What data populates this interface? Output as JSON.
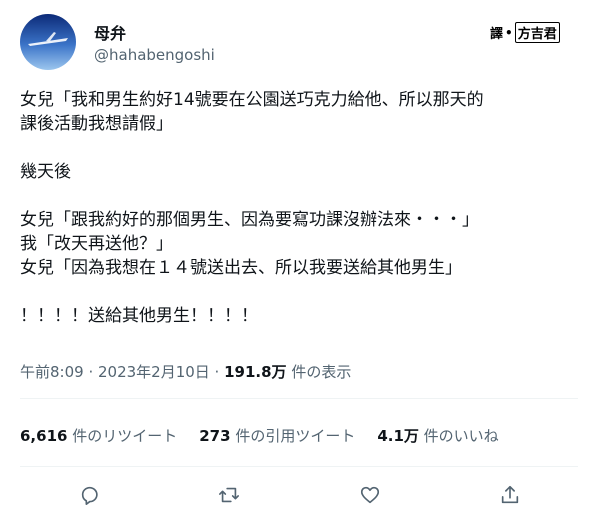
{
  "author": {
    "name": "母弁",
    "handle": "@hahabengoshi"
  },
  "translator_credit": {
    "prefix": "譯",
    "name": "方吉君"
  },
  "tweet_lines": [
    "女兒「我和男生約好14號要在公園送巧克力給他、所以那天的",
    "課後活動我想請假」",
    "",
    "幾天後",
    "",
    "女兒「跟我約好的那個男生、因為要寫功課沒辦法來・・・」",
    "我「改天再送他？」",
    "女兒「因為我想在１４號送出去、所以我要送給其他男生」",
    "",
    "！！！！送給其他男生！！！！"
  ],
  "meta": {
    "timestamp": "午前8:09 · 2023年2月10日 · ",
    "views": "191.8万",
    "views_label": " 件の表示"
  },
  "stats": {
    "retweets_count": "6,616",
    "retweets_label": " 件のリツイート",
    "quotes_count": "273",
    "quotes_label": " 件の引用ツイート",
    "likes_count": "4.1万",
    "likes_label": " 件のいいね"
  },
  "icons": [
    "reply-icon",
    "retweet-icon",
    "like-icon",
    "share-icon"
  ],
  "colors": {
    "text": "#0f1419",
    "secondary": "#536471",
    "divider": "#eff3f4"
  }
}
